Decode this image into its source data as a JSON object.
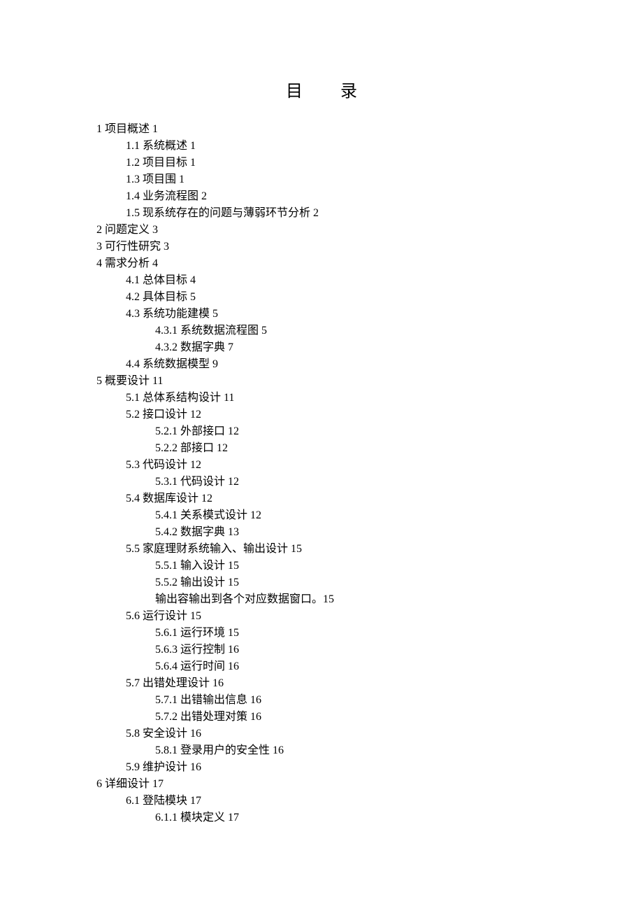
{
  "title": "目  录",
  "entries": [
    {
      "lvl": 1,
      "text": "1 项目概述 1"
    },
    {
      "lvl": 2,
      "text": "1.1 系统概述 1"
    },
    {
      "lvl": 2,
      "text": "1.2 项目目标 1"
    },
    {
      "lvl": 2,
      "text": "1.3 项目围 1"
    },
    {
      "lvl": 2,
      "text": "1.4 业务流程图 2"
    },
    {
      "lvl": 2,
      "text": "1.5 现系统存在的问题与薄弱环节分析 2"
    },
    {
      "lvl": 1,
      "text": "2 问题定义 3"
    },
    {
      "lvl": 1,
      "text": "3 可行性研究 3"
    },
    {
      "lvl": 1,
      "text": "4 需求分析 4"
    },
    {
      "lvl": 2,
      "text": "4.1 总体目标 4"
    },
    {
      "lvl": 2,
      "text": "4.2 具体目标 5"
    },
    {
      "lvl": 2,
      "text": "4.3 系统功能建模 5"
    },
    {
      "lvl": 3,
      "text": "4.3.1 系统数据流程图 5"
    },
    {
      "lvl": 3,
      "text": "4.3.2 数据字典 7"
    },
    {
      "lvl": 2,
      "text": "4.4 系统数据模型 9"
    },
    {
      "lvl": 1,
      "text": "5 概要设计 11"
    },
    {
      "lvl": 2,
      "text": "5.1 总体系结构设计 11"
    },
    {
      "lvl": 2,
      "text": "5.2 接口设计 12"
    },
    {
      "lvl": 3,
      "text": "5.2.1 外部接口 12"
    },
    {
      "lvl": 3,
      "text": "5.2.2 部接口 12"
    },
    {
      "lvl": 2,
      "text": "5.3 代码设计 12"
    },
    {
      "lvl": 3,
      "text": "5.3.1 代码设计 12"
    },
    {
      "lvl": 2,
      "text": "5.4 数据库设计 12"
    },
    {
      "lvl": 3,
      "text": "5.4.1 关系模式设计 12"
    },
    {
      "lvl": 3,
      "text": "5.4.2 数据字典 13"
    },
    {
      "lvl": 2,
      "text": "5.5 家庭理财系统输入、输出设计 15"
    },
    {
      "lvl": 3,
      "text": "5.5.1 输入设计 15"
    },
    {
      "lvl": 3,
      "text": "5.5.2 输出设计 15"
    },
    {
      "lvl": 3,
      "text": "输出容输出到各个对应数据窗口。15"
    },
    {
      "lvl": 2,
      "text": "5.6 运行设计 15"
    },
    {
      "lvl": 3,
      "text": "5.6.1 运行环境 15"
    },
    {
      "lvl": 3,
      "text": "5.6.3 运行控制 16"
    },
    {
      "lvl": 3,
      "text": "5.6.4 运行时间 16"
    },
    {
      "lvl": 2,
      "text": "5.7 出错处理设计 16"
    },
    {
      "lvl": 3,
      "text": "5.7.1 出错输出信息 16"
    },
    {
      "lvl": 3,
      "text": "5.7.2 出错处理对策 16"
    },
    {
      "lvl": 2,
      "text": "5.8 安全设计 16"
    },
    {
      "lvl": 3,
      "text": "5.8.1 登录用户的安全性 16"
    },
    {
      "lvl": 2,
      "text": "5.9 维护设计 16"
    },
    {
      "lvl": 1,
      "text": "6 详细设计 17"
    },
    {
      "lvl": 2,
      "text": "6.1 登陆模块 17"
    },
    {
      "lvl": 3,
      "text": "6.1.1 模块定义 17"
    }
  ]
}
